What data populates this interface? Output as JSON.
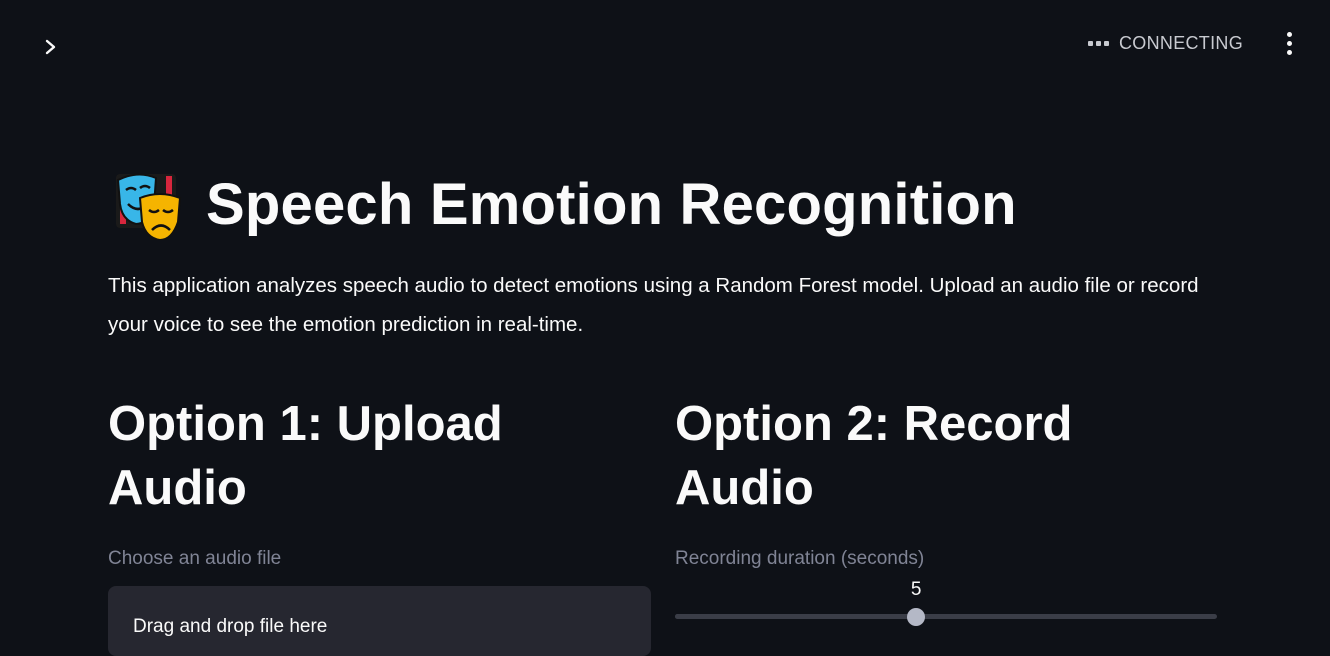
{
  "header": {
    "status_text": "CONNECTING"
  },
  "page": {
    "title": "Speech Emotion Recognition",
    "intro": "This application analyzes speech audio to detect emotions using a Random Forest model. Upload an audio file or record your voice to see the emotion prediction in real-time."
  },
  "option1": {
    "heading": "Option 1: Upload Audio",
    "uploader_label": "Choose an audio file",
    "dropzone_text": "Drag and drop file here"
  },
  "option2": {
    "heading": "Option 2: Record Audio",
    "slider_label": "Recording duration (seconds)",
    "slider_value": "5",
    "slider_fraction": 0.445
  },
  "icons": {
    "sidebar_toggle": "chevron-right-icon",
    "status": "ellipsis-icon",
    "menu": "vertical-dots-icon",
    "title_emoji": "performing-arts-icon"
  },
  "colors": {
    "background": "#0e1117",
    "widget_bg": "#262730",
    "muted_text": "#808495",
    "thumb": "#b4b8c6"
  }
}
